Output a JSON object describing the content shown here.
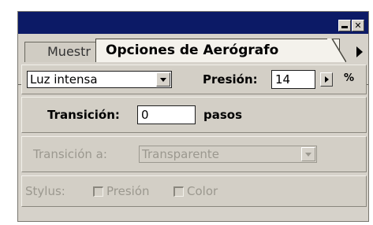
{
  "panel": {
    "title_buttons": {
      "minimize_icon": "minimize-icon",
      "close_glyph": "✕"
    },
    "tabs": [
      {
        "label": "Muestr",
        "active": false
      },
      {
        "label": "Opciones de Aerógrafo",
        "active": true
      }
    ]
  },
  "row1": {
    "mode_value": "Luz intensa",
    "pressure_label": "Presión:",
    "pressure_value": "14",
    "pressure_unit": "%"
  },
  "row2": {
    "fade_label": "Transición:",
    "fade_value": "0",
    "fade_unit": "pasos"
  },
  "row3": {
    "fade_to_label": "Transición a:",
    "fade_to_value": "Transparente"
  },
  "row4": {
    "stylus_label": "Stylus:",
    "opt_pressure": "Presión",
    "opt_color": "Color"
  },
  "colors": {
    "titlebar": "#0c1a66",
    "panel_bg": "#d6d2ca",
    "disabled_text": "#9b988f"
  }
}
